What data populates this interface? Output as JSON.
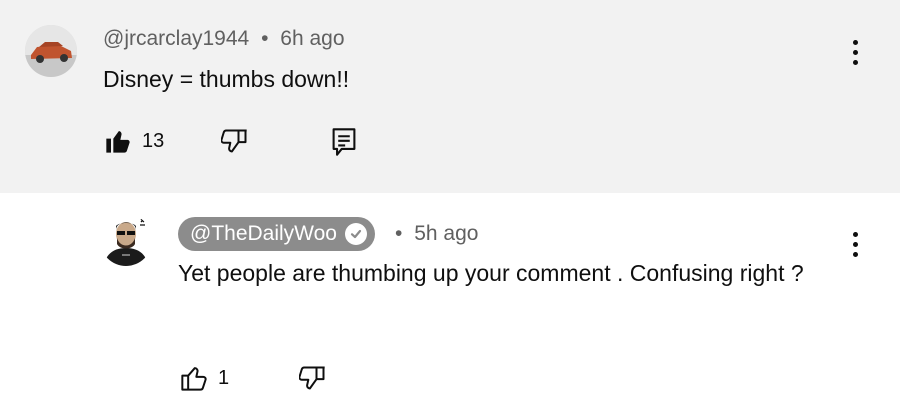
{
  "comment": {
    "handle": "@jrcarclay1944",
    "separator": "•",
    "time": "6h ago",
    "text": "Disney = thumbs down!!",
    "like_count": "13",
    "icons": {
      "like": "thumbs-up-filled-icon",
      "dislike": "thumbs-down-icon",
      "reply": "reply-icon",
      "menu": "more-vert-icon"
    }
  },
  "reply": {
    "handle": "@TheDailyWoo",
    "separator": "•",
    "time": "5h ago",
    "text": "Yet people are thumbing up your comment . Confusing right ?",
    "like_count": "1",
    "icons": {
      "like": "thumbs-up-icon",
      "dislike": "thumbs-down-icon",
      "verified": "verified-check-icon",
      "menu": "more-vert-icon"
    }
  },
  "colors": {
    "top_bg": "#f2f2f2",
    "badge_bg": "#8c8c8c",
    "meta_text": "#606060"
  }
}
